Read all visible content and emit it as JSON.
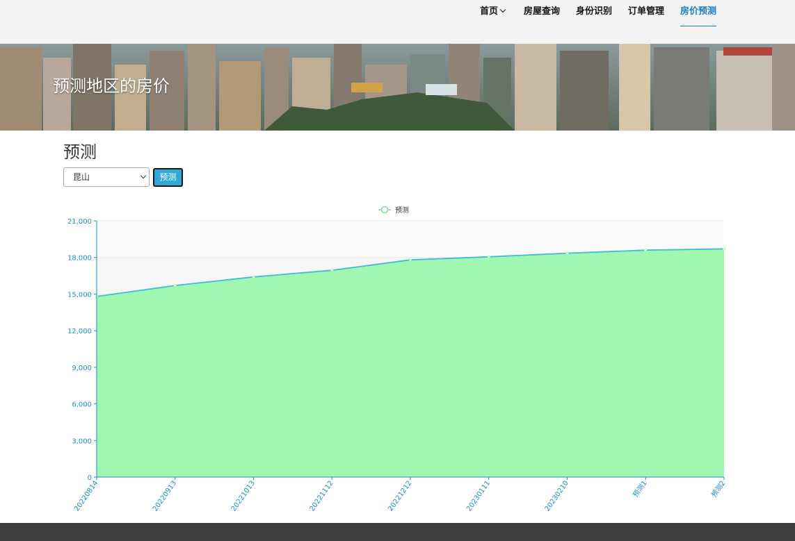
{
  "nav": {
    "items": [
      {
        "label": "首页",
        "dropdown": true,
        "active": false
      },
      {
        "label": "房屋查询",
        "dropdown": false,
        "active": false
      },
      {
        "label": "身份识别",
        "dropdown": false,
        "active": false
      },
      {
        "label": "订单管理",
        "dropdown": false,
        "active": false
      },
      {
        "label": "房价预测",
        "dropdown": false,
        "active": true
      }
    ]
  },
  "hero": {
    "title": "预测地区的房价"
  },
  "section": {
    "title": "预测"
  },
  "form": {
    "region_value": "昆山",
    "predict_button": "预测"
  },
  "colors": {
    "accent": "#1f7bc1",
    "area_fill": "#9ff7b0",
    "line": "#3fb9e0",
    "button": "#2fa9d8",
    "footer": "#3e3e3e"
  },
  "chart_data": {
    "type": "area",
    "legend": "预测",
    "legend_position": "top-center",
    "x": [
      "20220814",
      "20220913",
      "20221013",
      "20221112",
      "20221212",
      "20230111",
      "20230210",
      "预测1",
      "预测2"
    ],
    "y_tick_labels": [
      "0",
      "3,000",
      "6,000",
      "9,000",
      "12,000",
      "15,000",
      "18,000",
      "21,000"
    ],
    "ylim": [
      0,
      21000
    ],
    "series": [
      {
        "name": "预测",
        "values": [
          14800,
          15700,
          16400,
          16950,
          17800,
          18050,
          18350,
          18600,
          18700
        ]
      }
    ]
  }
}
